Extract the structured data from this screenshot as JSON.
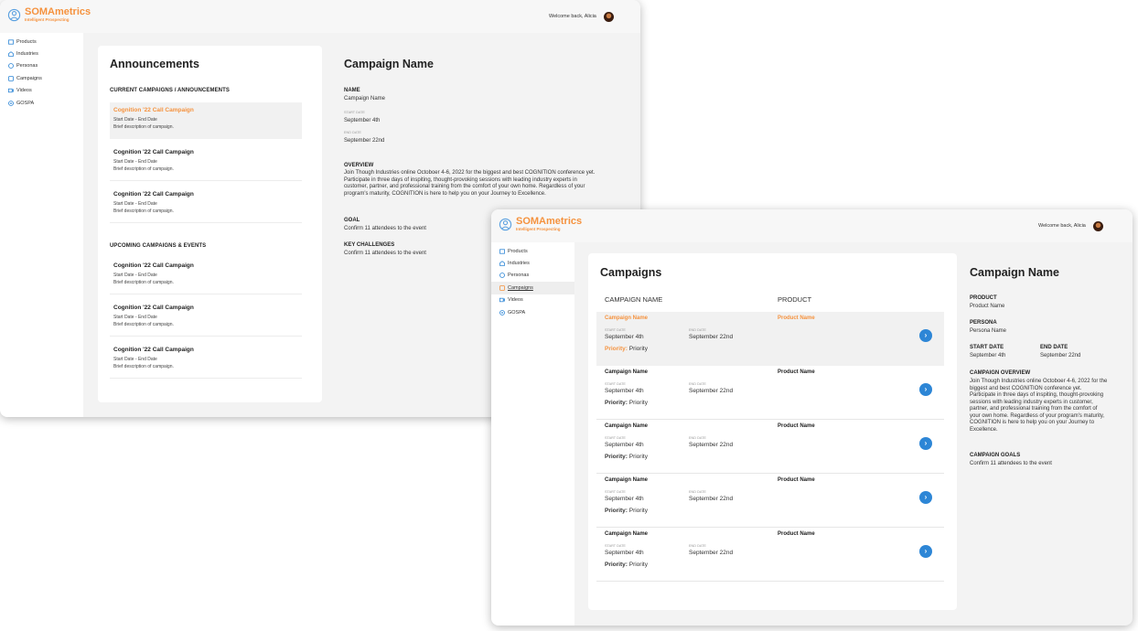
{
  "brand": {
    "name": "SOMAmetrics",
    "tagline": "Intelligent Prospecting"
  },
  "header": {
    "welcome": "Welcome back, Alicia"
  },
  "nav": [
    {
      "label": "Products",
      "icon": "box-icon"
    },
    {
      "label": "Industries",
      "icon": "building-icon"
    },
    {
      "label": "Personas",
      "icon": "persona-icon"
    },
    {
      "label": "Campaigns",
      "icon": "campaign-icon"
    },
    {
      "label": "Videos",
      "icon": "video-icon"
    },
    {
      "label": "GOSPA",
      "icon": "target-icon"
    }
  ],
  "announcements": {
    "title": "Announcements",
    "current_heading": "CURRENT CAMPAIGNS / ANNOUNCEMENTS",
    "upcoming_heading": "UPCOMING CAMPAIGNS & EVENTS",
    "current": [
      {
        "title": "Cognition '22 Call Campaign",
        "dates": "Start Date - End Date",
        "desc": "Brief description of campaign."
      },
      {
        "title": "Cognition '22 Call Campaign",
        "dates": "Start Date - End Date",
        "desc": "Brief description of campaign."
      },
      {
        "title": "Cognition '22 Call Campaign",
        "dates": "Start Date - End Date",
        "desc": "Brief description of campaign."
      }
    ],
    "upcoming": [
      {
        "title": "Cognition '22 Call Campaign",
        "dates": "Start Date - End Date",
        "desc": "Brief description of campaign."
      },
      {
        "title": "Cognition '22 Call Campaign",
        "dates": "Start Date - End Date",
        "desc": "Brief description of campaign."
      },
      {
        "title": "Cognition '22 Call Campaign",
        "dates": "Start Date - End Date",
        "desc": "Brief description of campaign."
      }
    ]
  },
  "detail1": {
    "title": "Campaign Name",
    "name_label": "NAME",
    "name_value": "Campaign Name",
    "start_label": "START DATE",
    "start_value": "September 4th",
    "end_label": "END DATE",
    "end_value": "September 22nd",
    "overview_label": "OVERVIEW",
    "overview_text": "Join Though Industries online Octoboer 4-6, 2022 for the biggest and best COGNITION conference yet. Participate in three days of inspiting, thought-provoking sessions with leading industry experts in customer, partner, and professional training from the comfort of your own home. Regardless of your program's maturity, COGNITION is here to help you on your Journey to Excellence.",
    "goal_label": "GOAL",
    "goal_text": "Confirm 11 attendees to the event",
    "challenges_label": "KEY CHALLENGES",
    "challenges_text": "Confirm 11 attendees to the event"
  },
  "campaigns": {
    "title": "Campaigns",
    "col_name": "CAMPAIGN NAME",
    "col_product": "PRODUCT",
    "rows": [
      {
        "name": "Campaign Name",
        "product": "Product Name",
        "start_label": "START DATE",
        "start": "September 4th",
        "end_label": "END DATE",
        "end": "September 22nd",
        "priority_label": "Priority:",
        "priority": "Priority"
      },
      {
        "name": "Campaign Name",
        "product": "Product Name",
        "start_label": "START DATE",
        "start": "September 4th",
        "end_label": "END DATE",
        "end": "September 22nd",
        "priority_label": "Priority:",
        "priority": "Priority"
      },
      {
        "name": "Campaign Name",
        "product": "Product Name",
        "start_label": "START DATE",
        "start": "September 4th",
        "end_label": "END DATE",
        "end": "September 22nd",
        "priority_label": "Priority:",
        "priority": "Priority"
      },
      {
        "name": "Campaign Name",
        "product": "Product Name",
        "start_label": "START DATE",
        "start": "September 4th",
        "end_label": "END DATE",
        "end": "September 22nd",
        "priority_label": "Priority:",
        "priority": "Priority"
      },
      {
        "name": "Campaign Name",
        "product": "Product Name",
        "start_label": "START DATE",
        "start": "September 4th",
        "end_label": "END DATE",
        "end": "September 22nd",
        "priority_label": "Priority:",
        "priority": "Priority"
      }
    ]
  },
  "detail2": {
    "title": "Campaign Name",
    "product_label": "PRODUCT",
    "product_value": "Product Name",
    "persona_label": "PERSONA",
    "persona_value": "Persona Name",
    "start_label": "START DATE",
    "start_value": "September 4th",
    "end_label": "END DATE",
    "end_value": "September 22nd",
    "overview_label": "CAMPAIGN OVERVIEW",
    "overview_text": "Join Though Industries online Octoboer 4-6, 2022 for the biggest and best COGNITION conference yet. Participate in three days of inspiting, thought-provoking sessions with leading industry experts in customer, partner, and professional training from the comfort of your own home. Regardless of your program's maturity, COGNITION is here to help you on your Journey to Excellence.",
    "goals_label": "CAMPAIGN GOALS",
    "goals_text": "Confirm 11 attendees to the event"
  },
  "colors": {
    "accent": "#f5923e",
    "action": "#2d86d6",
    "background": "#f3f3f3"
  }
}
